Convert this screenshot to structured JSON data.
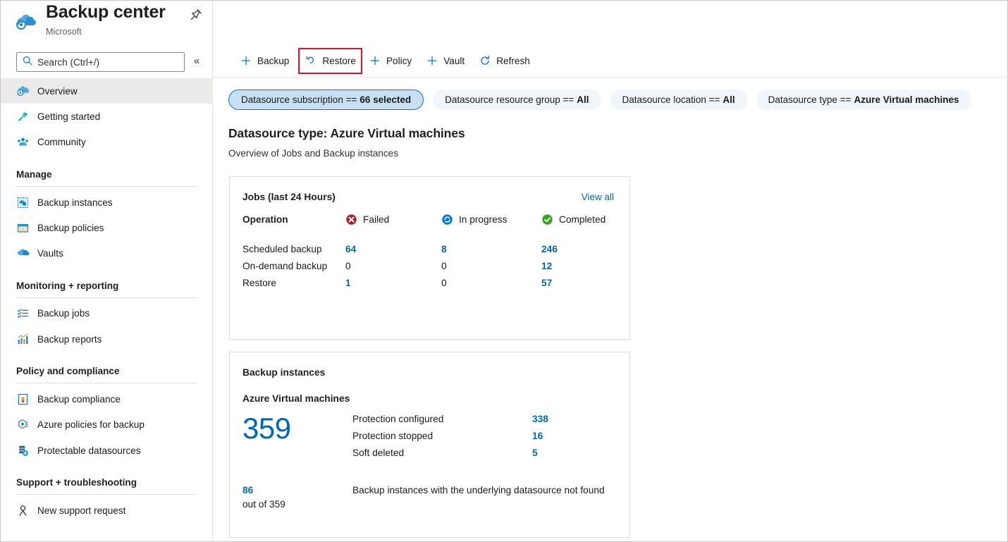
{
  "blade": {
    "title": "Backup center",
    "subtitle": "Microsoft",
    "pin_icon": "pin-icon",
    "more_icon": "ellipsis-icon",
    "logo_icon": "backup-center-logo-icon"
  },
  "search": {
    "placeholder": "Search (Ctrl+/)",
    "value": "",
    "icon": "search-icon",
    "collapse_icon": "chevron-double-left-icon"
  },
  "sidebar": {
    "top_items": [
      {
        "label": "Overview",
        "icon": "cloud-backup-icon",
        "selected": true
      },
      {
        "label": "Getting started",
        "icon": "rocket-flag-icon",
        "selected": false
      },
      {
        "label": "Community",
        "icon": "community-icon",
        "selected": false
      }
    ],
    "groups": [
      {
        "title": "Manage",
        "items": [
          {
            "label": "Backup instances",
            "icon": "backup-instances-icon"
          },
          {
            "label": "Backup policies",
            "icon": "backup-policies-icon"
          },
          {
            "label": "Vaults",
            "icon": "vaults-cloud-icon"
          }
        ]
      },
      {
        "title": "Monitoring + reporting",
        "items": [
          {
            "label": "Backup jobs",
            "icon": "checklist-icon"
          },
          {
            "label": "Backup reports",
            "icon": "bar-chart-icon"
          }
        ]
      },
      {
        "title": "Policy and compliance",
        "items": [
          {
            "label": "Backup compliance",
            "icon": "compliance-document-icon"
          },
          {
            "label": "Azure policies for backup",
            "icon": "policy-hexagon-icon"
          },
          {
            "label": "Protectable datasources",
            "icon": "datasource-icon"
          }
        ]
      },
      {
        "title": "Support + troubleshooting",
        "items": [
          {
            "label": "New support request",
            "icon": "support-person-icon"
          }
        ]
      }
    ]
  },
  "toolbar": {
    "buttons": [
      {
        "label": "Backup",
        "icon": "plus-icon",
        "highlighted": false
      },
      {
        "label": "Restore",
        "icon": "restore-undo-icon",
        "highlighted": true
      },
      {
        "label": "Policy",
        "icon": "plus-icon",
        "highlighted": false
      },
      {
        "label": "Vault",
        "icon": "plus-icon",
        "highlighted": false
      },
      {
        "label": "Refresh",
        "icon": "refresh-icon",
        "highlighted": false
      }
    ],
    "highlight_color": "#e8112d"
  },
  "filters": [
    {
      "label": "Datasource subscription ==",
      "value": "66 selected",
      "active": true
    },
    {
      "label": "Datasource resource group ==",
      "value": "All",
      "active": false
    },
    {
      "label": "Datasource location ==",
      "value": "All",
      "active": false
    },
    {
      "label": "Datasource type ==",
      "value": "Azure Virtual machines",
      "active": false
    }
  ],
  "heading": {
    "title": "Datasource type: Azure Virtual machines",
    "subtitle": "Overview of Jobs and Backup instances"
  },
  "jobs_card": {
    "title": "Jobs (last 24 Hours)",
    "view_all": "View all",
    "columns": [
      {
        "label": "Operation",
        "icon": null
      },
      {
        "label": "Failed",
        "icon": "error-circle-icon",
        "color": "#a4262c"
      },
      {
        "label": "In progress",
        "icon": "in-progress-circle-icon",
        "color": "#0078d4"
      },
      {
        "label": "Completed",
        "icon": "success-circle-icon",
        "color": "#107c10"
      }
    ],
    "rows": [
      {
        "operation": "Scheduled backup",
        "failed": "64",
        "in_progress": "8",
        "completed": "246"
      },
      {
        "operation": "On-demand backup",
        "failed": "0",
        "in_progress": "0",
        "completed": "12"
      },
      {
        "operation": "Restore",
        "failed": "1",
        "in_progress": "0",
        "completed": "57"
      }
    ]
  },
  "instances_card": {
    "title": "Backup instances",
    "subtitle": "Azure Virtual machines",
    "total": "359",
    "rows": [
      {
        "label": "Protection configured",
        "value": "338"
      },
      {
        "label": "Protection stopped",
        "value": "16"
      },
      {
        "label": "Soft deleted",
        "value": "5"
      }
    ],
    "footer": {
      "count": "86",
      "of_text": "out of 359",
      "description": "Backup instances with the underlying datasource not found"
    }
  },
  "colors": {
    "link": "#0067b8",
    "accent": "#0078d4",
    "pill_active_bg": "#c7e0f4",
    "pill_bg": "#eff6fc",
    "error": "#a4262c",
    "success": "#107c10"
  }
}
